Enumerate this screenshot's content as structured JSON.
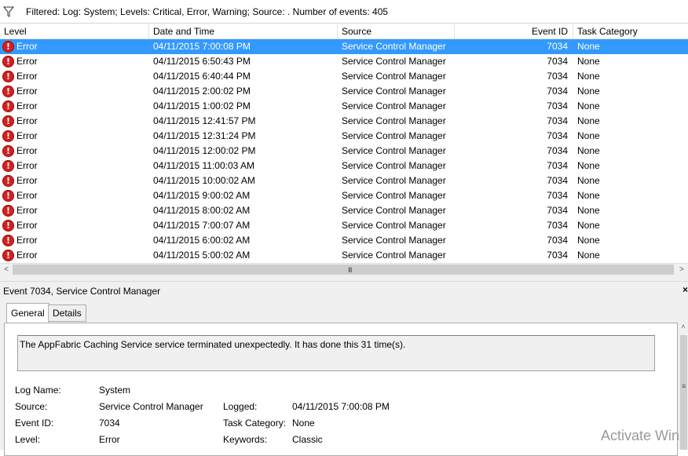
{
  "filter": {
    "icon": "funnel-icon",
    "text": "Filtered: Log: System; Levels: Critical, Error, Warning; Source: . Number of events: 405"
  },
  "grid": {
    "columns": [
      "Level",
      "Date and Time",
      "Source",
      "Event ID",
      "Task Category"
    ],
    "rows": [
      {
        "level": "Error",
        "datetime": "04/11/2015 7:00:08 PM",
        "source": "Service Control Manager",
        "event_id": "7034",
        "task": "None"
      },
      {
        "level": "Error",
        "datetime": "04/11/2015 6:50:43 PM",
        "source": "Service Control Manager",
        "event_id": "7034",
        "task": "None"
      },
      {
        "level": "Error",
        "datetime": "04/11/2015 6:40:44 PM",
        "source": "Service Control Manager",
        "event_id": "7034",
        "task": "None"
      },
      {
        "level": "Error",
        "datetime": "04/11/2015 2:00:02 PM",
        "source": "Service Control Manager",
        "event_id": "7034",
        "task": "None"
      },
      {
        "level": "Error",
        "datetime": "04/11/2015 1:00:02 PM",
        "source": "Service Control Manager",
        "event_id": "7034",
        "task": "None"
      },
      {
        "level": "Error",
        "datetime": "04/11/2015 12:41:57 PM",
        "source": "Service Control Manager",
        "event_id": "7034",
        "task": "None"
      },
      {
        "level": "Error",
        "datetime": "04/11/2015 12:31:24 PM",
        "source": "Service Control Manager",
        "event_id": "7034",
        "task": "None"
      },
      {
        "level": "Error",
        "datetime": "04/11/2015 12:00:02 PM",
        "source": "Service Control Manager",
        "event_id": "7034",
        "task": "None"
      },
      {
        "level": "Error",
        "datetime": "04/11/2015 11:00:03 AM",
        "source": "Service Control Manager",
        "event_id": "7034",
        "task": "None"
      },
      {
        "level": "Error",
        "datetime": "04/11/2015 10:00:02 AM",
        "source": "Service Control Manager",
        "event_id": "7034",
        "task": "None"
      },
      {
        "level": "Error",
        "datetime": "04/11/2015 9:00:02 AM",
        "source": "Service Control Manager",
        "event_id": "7034",
        "task": "None"
      },
      {
        "level": "Error",
        "datetime": "04/11/2015 8:00:02 AM",
        "source": "Service Control Manager",
        "event_id": "7034",
        "task": "None"
      },
      {
        "level": "Error",
        "datetime": "04/11/2015 7:00:07 AM",
        "source": "Service Control Manager",
        "event_id": "7034",
        "task": "None"
      },
      {
        "level": "Error",
        "datetime": "04/11/2015 6:00:02 AM",
        "source": "Service Control Manager",
        "event_id": "7034",
        "task": "None"
      },
      {
        "level": "Error",
        "datetime": "04/11/2015 5:00:02 AM",
        "source": "Service Control Manager",
        "event_id": "7034",
        "task": "None"
      }
    ],
    "selected_row": 0,
    "row_icon": "error-icon",
    "selection_color": "#3399ff"
  },
  "hscroll": {
    "left": "<",
    "right": ">",
    "grip": "III"
  },
  "details": {
    "title": "Event 7034, Service Control Manager",
    "close": "×",
    "tabs": [
      "General",
      "Details"
    ],
    "active_tab": "General",
    "message": "The AppFabric Caching Service service terminated unexpectedly.  It has done this 31 time(s).",
    "fields": {
      "log_name_label": "Log Name:",
      "log_name_value": "System",
      "source_label": "Source:",
      "source_value": "Service Control Manager",
      "logged_label": "Logged:",
      "logged_value": "04/11/2015 7:00:08 PM",
      "event_id_label": "Event ID:",
      "event_id_value": "7034",
      "task_category_label": "Task Category:",
      "task_category_value": "None",
      "level_label": "Level:",
      "level_value": "Error",
      "keywords_label": "Keywords:",
      "keywords_value": "Classic"
    }
  },
  "vscroll": {
    "up": "˄",
    "grip": "≡"
  },
  "watermark": "Activate Win"
}
